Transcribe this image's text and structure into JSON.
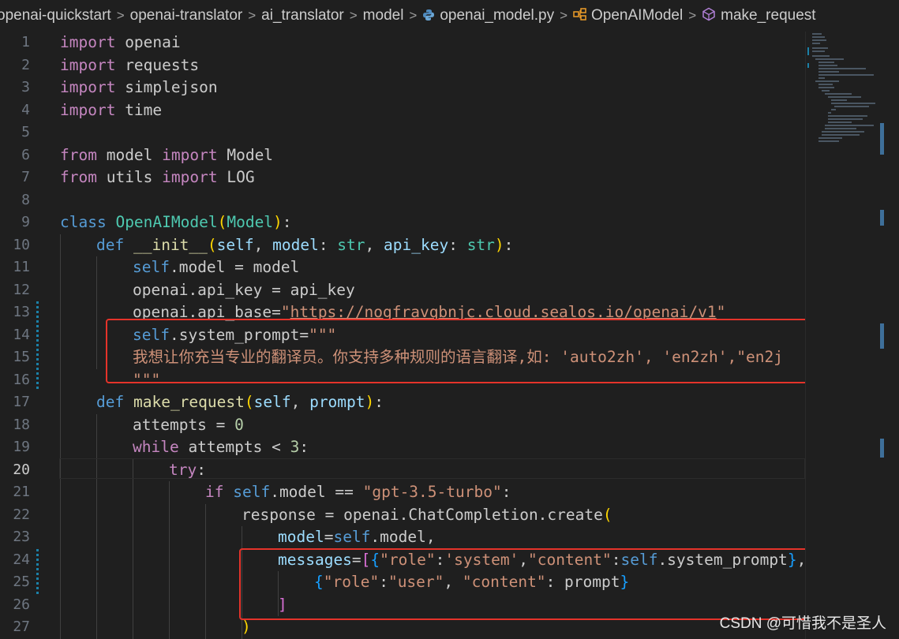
{
  "breadcrumb": {
    "items": [
      "openai-quickstart",
      "openai-translator",
      "ai_translator",
      "model",
      "openai_model.py",
      "OpenAIModel",
      "make_request"
    ],
    "separator": ">",
    "file_icon": "python-file-icon",
    "class_icon": "class-icon",
    "method_icon": "method-icon"
  },
  "editor": {
    "line_numbers": [
      "1",
      "2",
      "3",
      "4",
      "5",
      "6",
      "7",
      "8",
      "9",
      "10",
      "11",
      "12",
      "13",
      "14",
      "15",
      "16",
      "17",
      "18",
      "19",
      "20",
      "21",
      "22",
      "23",
      "24",
      "25",
      "26",
      "27"
    ],
    "current_line": "20",
    "code": {
      "l1": {
        "a": "import",
        "b": " openai"
      },
      "l2": {
        "a": "import",
        "b": " requests"
      },
      "l3": {
        "a": "import",
        "b": " simplejson"
      },
      "l4": {
        "a": "import",
        "b": " time"
      },
      "l6": {
        "a": "from",
        "b": " model ",
        "c": "import",
        "d": " Model"
      },
      "l7": {
        "a": "from",
        "b": " utils ",
        "c": "import",
        "d": " LOG"
      },
      "l9": {
        "a": "class",
        "b": " ",
        "c": "OpenAIModel",
        "d": "(",
        "e": "Model",
        "f": ")",
        "g": ":"
      },
      "l10": {
        "a": "def",
        "b": " ",
        "c": "__init__",
        "d": "(",
        "e": "self",
        "f": ", ",
        "g": "model",
        "h": ": ",
        "i": "str",
        "j": ", ",
        "k": "api_key",
        "l": ": ",
        "m": "str",
        "n": ")",
        "o": ":"
      },
      "l11": {
        "a": "self",
        "b": ".model = model"
      },
      "l12": {
        "a": "openai.api_key = api_key"
      },
      "l13": {
        "a": "openai.api_base=",
        "b": "\"",
        "c": "https://nogfravqbnjc.cloud.sealos.io/openai/v1",
        "d": "\""
      },
      "l14": {
        "a": "self",
        "b": ".system_prompt=",
        "c": "\"\"\""
      },
      "l15": {
        "a": "我想让你充当专业的翻译员。你支持多种规则的语言翻译,如: 'auto2zh', 'en2zh',\"en2j"
      },
      "l16": {
        "a": "\"\"\""
      },
      "l17": {
        "a": "def",
        "b": " ",
        "c": "make_request",
        "d": "(",
        "e": "self",
        "f": ", ",
        "g": "prompt",
        "h": ")",
        "i": ":"
      },
      "l18": {
        "a": "attempts = ",
        "b": "0"
      },
      "l19": {
        "a": "while",
        "b": " attempts < ",
        "c": "3",
        "d": ":"
      },
      "l20": {
        "a": "try",
        "b": ":"
      },
      "l21": {
        "a": "if",
        "b": " ",
        "c": "self",
        "d": ".model == ",
        "e": "\"gpt-3.5-turbo\"",
        "f": ":"
      },
      "l22": {
        "a": "response = openai.ChatCompletion.create",
        "b": "("
      },
      "l23": {
        "a": "model",
        "b": "=",
        "c": "self",
        "d": ".model,"
      },
      "l24": {
        "a": "messages",
        "b": "=",
        "c": "[",
        "d": "{",
        "e": "\"role\"",
        "f": ":",
        "g": "'system'",
        "h": ",",
        "i": "\"content\"",
        "j": ":",
        "k": "self",
        "l": ".system_prompt",
        "m": "}",
        "n": ","
      },
      "l25": {
        "a": "{",
        "b": "\"role\"",
        "c": ":",
        "d": "\"user\"",
        "e": ", ",
        "f": "\"content\"",
        "g": ": prompt",
        "h": "}"
      },
      "l26": {
        "a": "]"
      },
      "l27": {
        "a": ")"
      }
    }
  },
  "watermark": "CSDN @可惜我不是圣人",
  "colors": {
    "background": "#1f1f1f",
    "keyword": "#569cd6",
    "control_keyword": "#c586c0",
    "class_name": "#4ec9b0",
    "function": "#dcdcaa",
    "variable": "#9cdcfe",
    "string": "#ce9178",
    "number": "#b5cea8",
    "annotation_box": "#e5332a"
  }
}
